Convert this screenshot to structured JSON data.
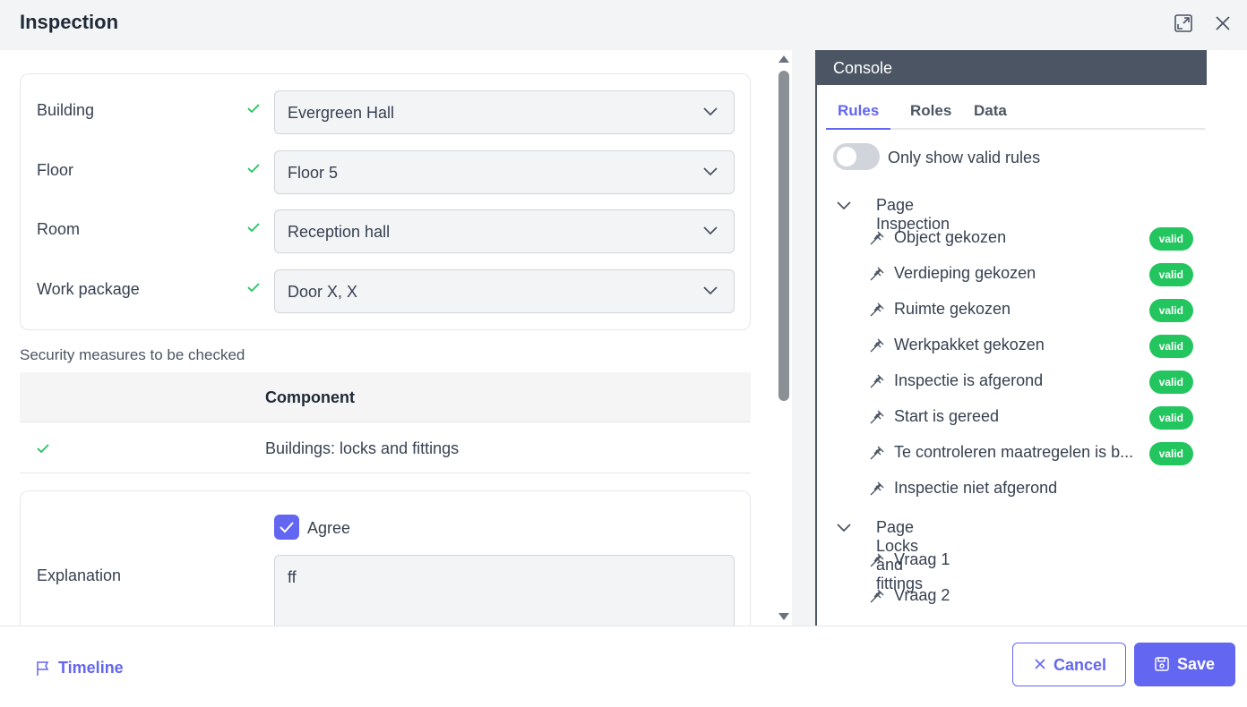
{
  "header": {
    "title": "Inspection",
    "icons": {
      "expand": "expand-icon",
      "close": "close-icon"
    }
  },
  "form": {
    "fields": [
      {
        "label": "Building",
        "value": "Evergreen Hall",
        "valid": true
      },
      {
        "label": "Floor",
        "value": "Floor 5",
        "valid": true
      },
      {
        "label": "Room",
        "value": "Reception hall",
        "valid": true
      },
      {
        "label": "Work package",
        "value": "Door X, X",
        "valid": true
      }
    ]
  },
  "security": {
    "heading": "Security measures to be checked",
    "column_header": "Component",
    "rows": [
      {
        "checked": true,
        "component": "Buildings: locks and fittings"
      }
    ]
  },
  "explanation": {
    "agree_label": "Agree",
    "agree_checked": true,
    "label": "Explanation",
    "value": "ff"
  },
  "console": {
    "title": "Console",
    "tabs": [
      {
        "label": "Rules",
        "active": true
      },
      {
        "label": "Roles",
        "active": false
      },
      {
        "label": "Data",
        "active": false
      }
    ],
    "toggle": {
      "label": "Only show valid rules",
      "on": false
    },
    "groups": [
      {
        "label": "Page Inspection",
        "rules": [
          {
            "label": "Object gekozen",
            "badge": "valid"
          },
          {
            "label": "Verdieping gekozen",
            "badge": "valid"
          },
          {
            "label": "Ruimte gekozen",
            "badge": "valid"
          },
          {
            "label": "Werkpakket gekozen",
            "badge": "valid"
          },
          {
            "label": "Inspectie is afgerond",
            "badge": "valid"
          },
          {
            "label": "Start is gereed",
            "badge": "valid"
          },
          {
            "label": "Te controleren maatregelen is b...",
            "badge": "valid"
          },
          {
            "label": "Inspectie niet afgerond",
            "badge": ""
          }
        ]
      },
      {
        "label": "Page Locks and fittings",
        "rules": [
          {
            "label": "Vraag 1",
            "badge": ""
          },
          {
            "label": "Vraag 2",
            "badge": ""
          }
        ]
      }
    ]
  },
  "footer": {
    "timeline_label": "Timeline",
    "cancel_label": "Cancel",
    "save_label": "Save"
  },
  "colors": {
    "accent": "#6366f1",
    "valid": "#22c55e",
    "console_header": "#4b5563"
  }
}
